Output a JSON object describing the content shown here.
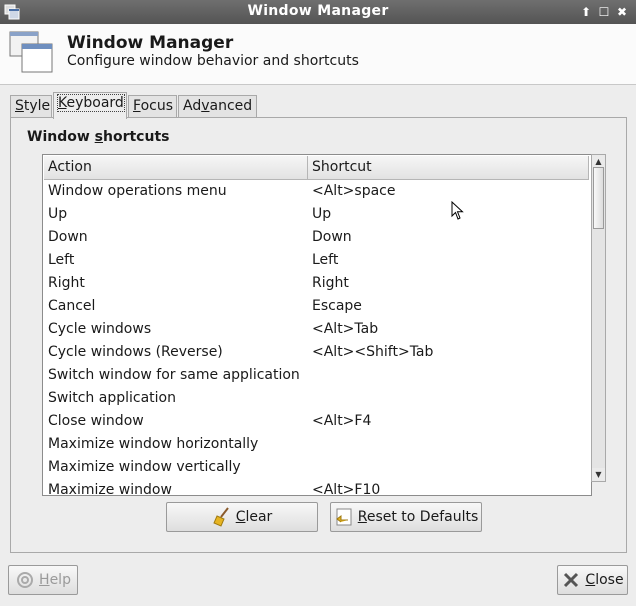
{
  "window": {
    "title": "Window Manager",
    "controls": [
      "up-arrow-icon",
      "maximize-icon",
      "close-icon"
    ]
  },
  "header": {
    "title": "Window Manager",
    "subtitle": "Configure window behavior and shortcuts"
  },
  "tabs": [
    {
      "pre": "",
      "mn": "S",
      "post": "tyle",
      "active": false
    },
    {
      "pre": "",
      "mn": "K",
      "post": "eyboard",
      "active": true
    },
    {
      "pre": "",
      "mn": "F",
      "post": "ocus",
      "active": false
    },
    {
      "pre": "Ad",
      "mn": "v",
      "post": "anced",
      "active": false
    }
  ],
  "shortcuts": {
    "title_pre": "Window ",
    "title_mn": "s",
    "title_post": "hortcuts",
    "columns": [
      "Action",
      "Shortcut"
    ],
    "rows": [
      {
        "action": "Window operations menu",
        "shortcut": "<Alt>space"
      },
      {
        "action": "Up",
        "shortcut": "Up"
      },
      {
        "action": "Down",
        "shortcut": "Down"
      },
      {
        "action": "Left",
        "shortcut": "Left"
      },
      {
        "action": "Right",
        "shortcut": "Right"
      },
      {
        "action": "Cancel",
        "shortcut": "Escape"
      },
      {
        "action": "Cycle windows",
        "shortcut": "<Alt>Tab"
      },
      {
        "action": "Cycle windows (Reverse)",
        "shortcut": "<Alt><Shift>Tab"
      },
      {
        "action": "Switch window for same application",
        "shortcut": ""
      },
      {
        "action": "Switch application",
        "shortcut": ""
      },
      {
        "action": "Close window",
        "shortcut": "<Alt>F4"
      },
      {
        "action": "Maximize window horizontally",
        "shortcut": ""
      },
      {
        "action": "Maximize window vertically",
        "shortcut": ""
      },
      {
        "action": "Maximize window",
        "shortcut": "<Alt>F10"
      }
    ]
  },
  "buttons": {
    "clear": {
      "pre": "",
      "mn": "C",
      "post": "lear"
    },
    "reset": {
      "pre": "",
      "mn": "R",
      "post": "eset to Defaults"
    },
    "help": {
      "pre": "",
      "mn": "H",
      "post": "elp"
    },
    "close": {
      "pre": "",
      "mn": "C",
      "post": "lose"
    }
  },
  "colors": {
    "titlebar": "#5e5e5e",
    "window_bg": "#ededed"
  }
}
